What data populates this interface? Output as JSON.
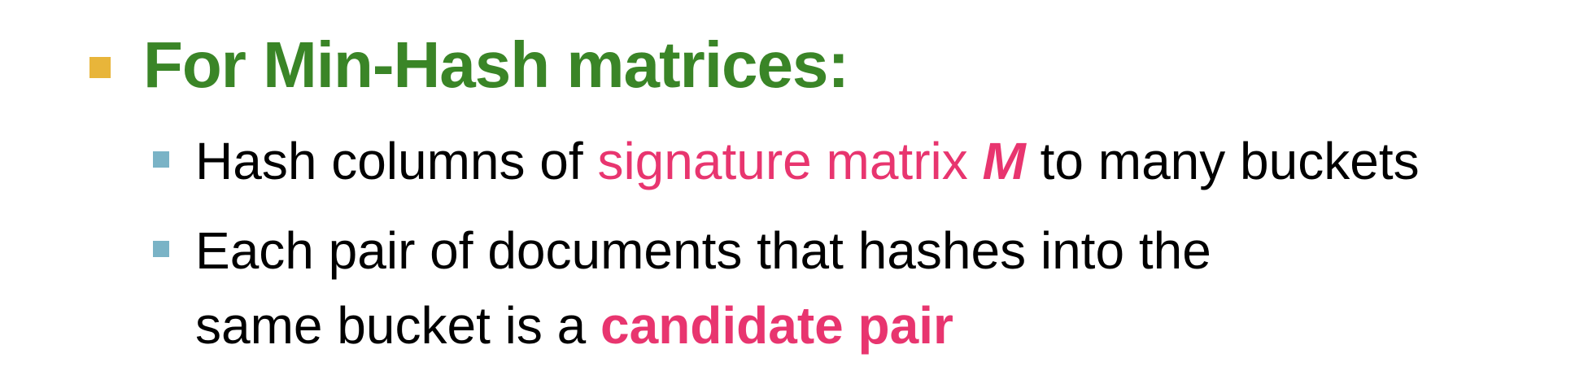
{
  "colors": {
    "heading": "#3a8527",
    "accent": "#e8356f",
    "bullet_l1": "#e8b53a",
    "bullet_l2": "#7ab3c6",
    "text": "#000000"
  },
  "icons": {
    "l1_bullet": "square-bullet-icon",
    "l2_bullet": "square-bullet-icon"
  },
  "heading": {
    "text": "For Min-Hash matrices:"
  },
  "bullet1": {
    "before": "Hash columns of ",
    "highlight": "signature matrix ",
    "symbol": "M",
    "after": " to many buckets"
  },
  "bullet2": {
    "line1": "Each pair of documents that hashes into the",
    "line2_before": "same bucket is a ",
    "line2_highlight": "candidate pair"
  }
}
